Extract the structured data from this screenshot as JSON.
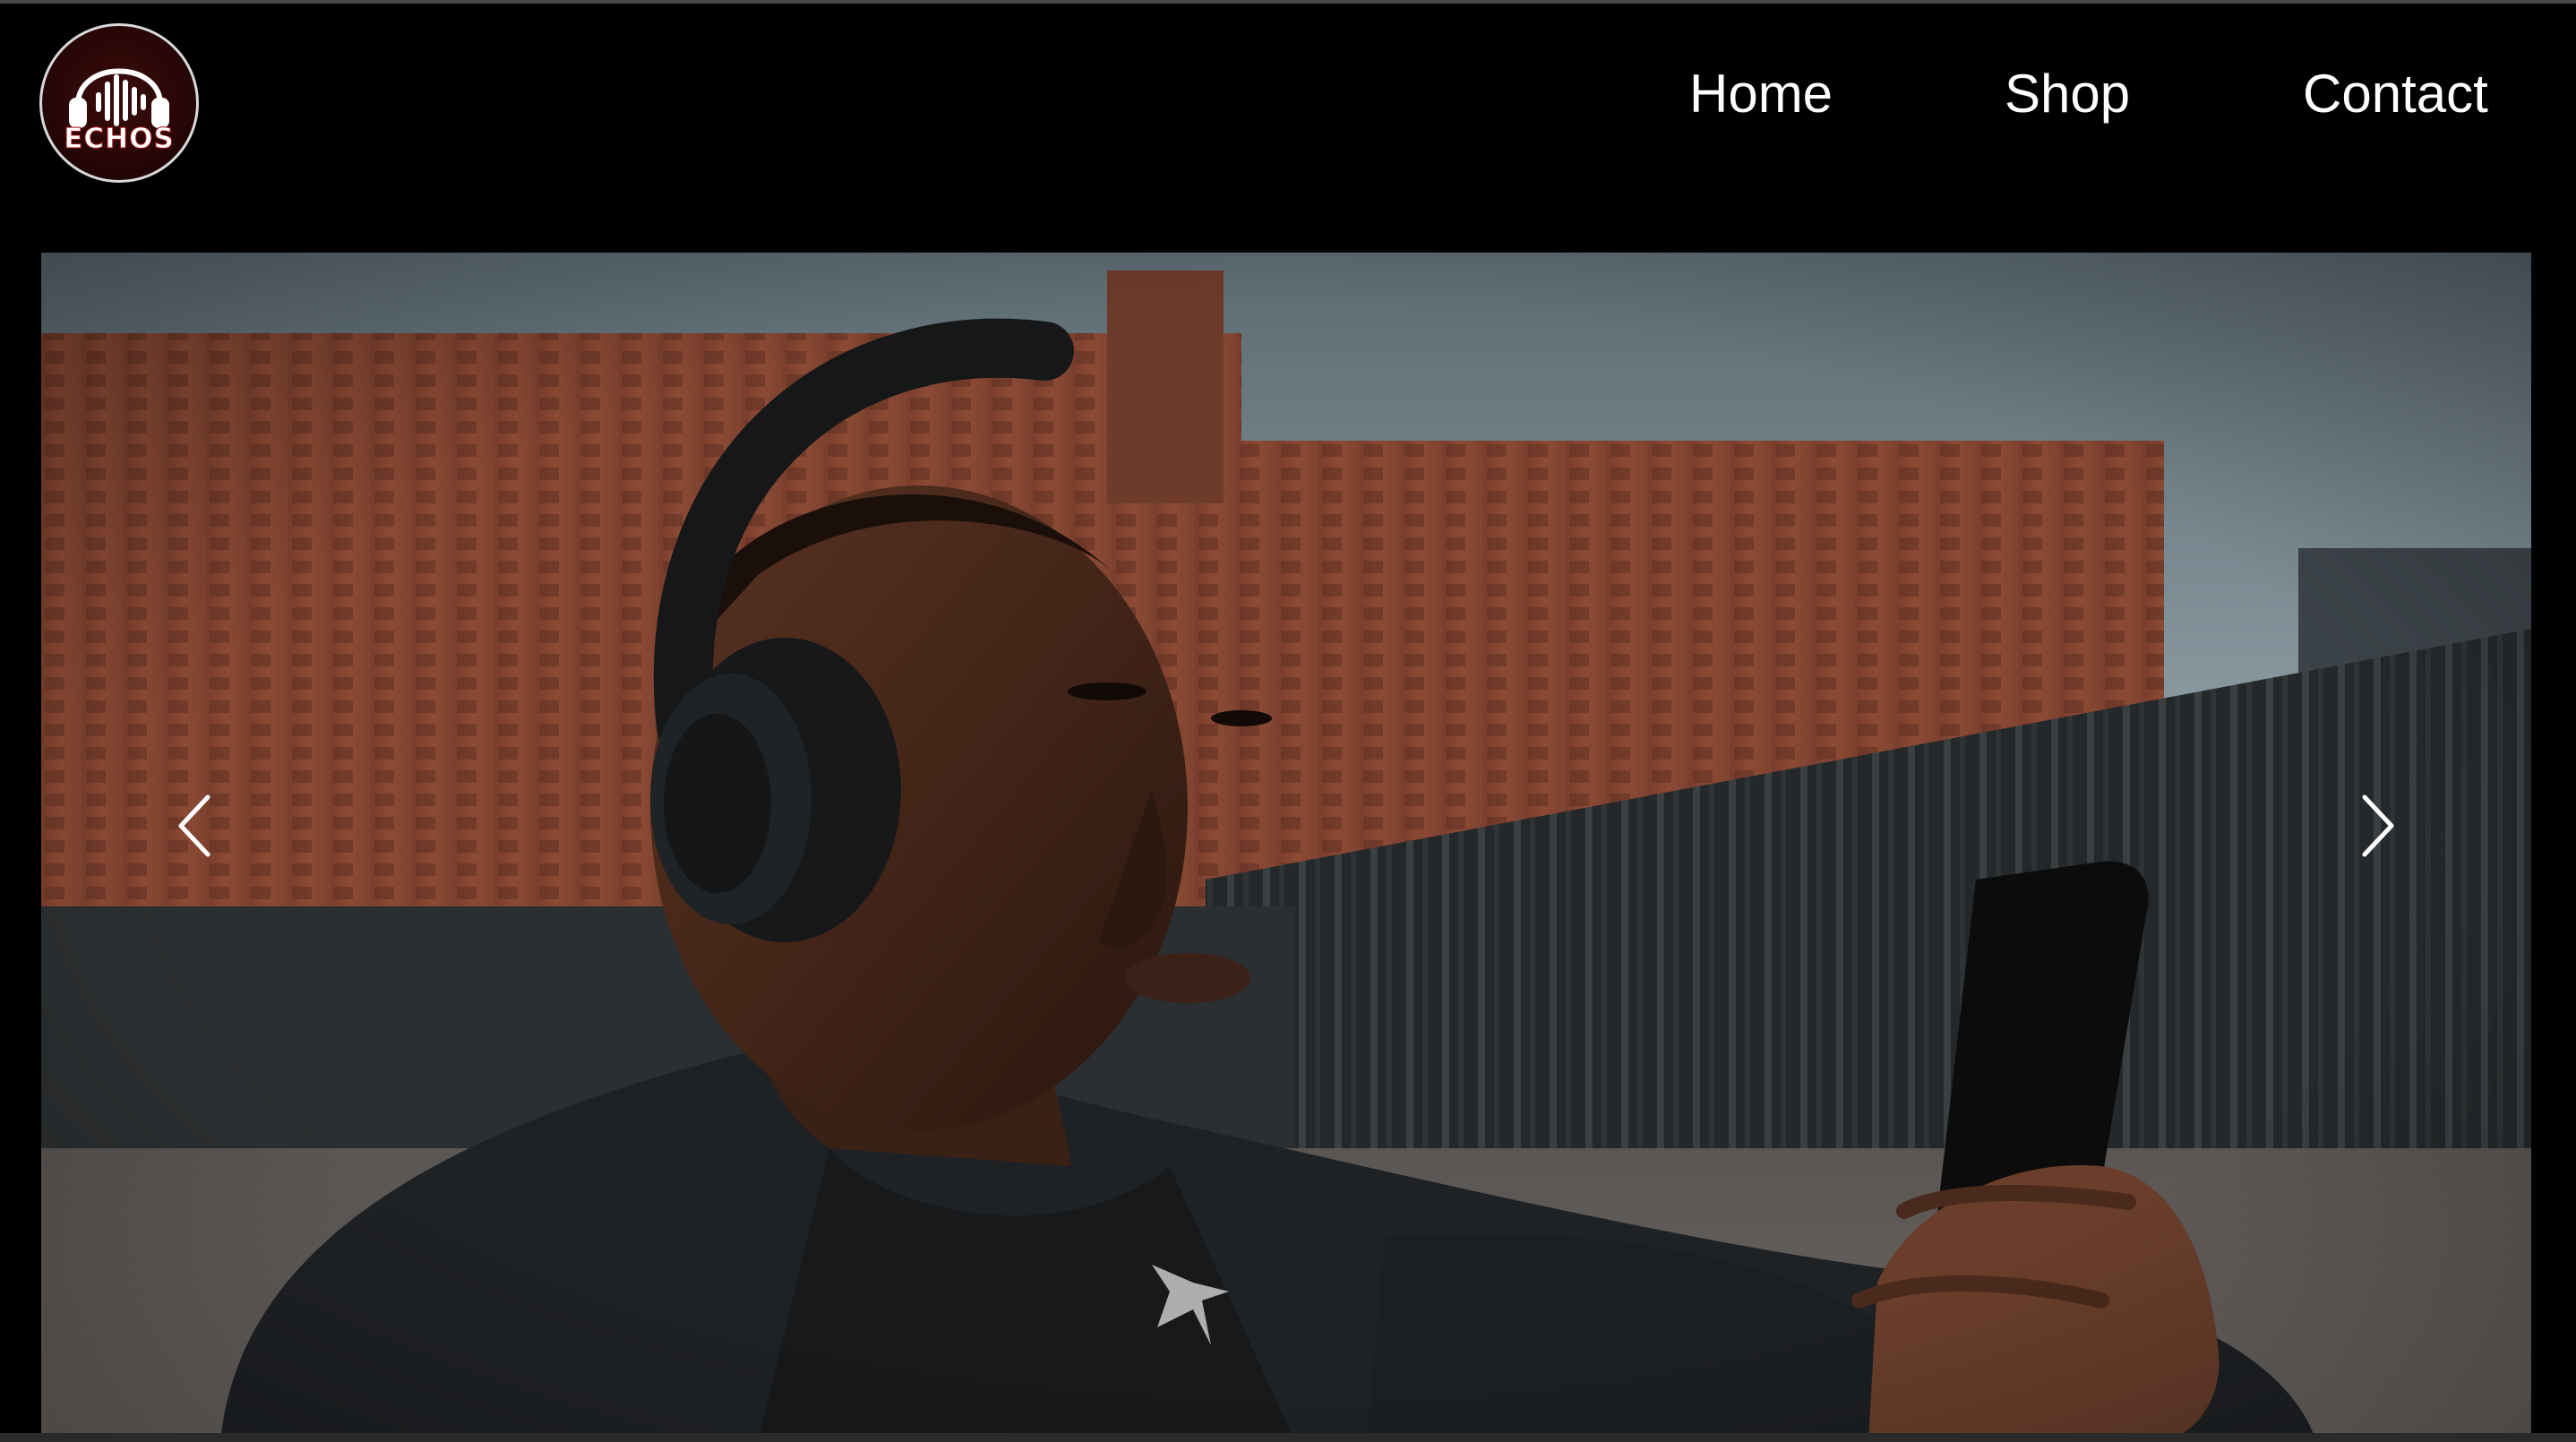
{
  "brand": {
    "logo_text": "ECHOS",
    "logo_icon": "headphones-soundwave-icon",
    "accent_color": "#a01616"
  },
  "nav": {
    "items": [
      {
        "label": "Home"
      },
      {
        "label": "Shop"
      },
      {
        "label": "Contact"
      }
    ]
  },
  "carousel": {
    "slide_image": "man-wearing-headphones-looking-at-phone",
    "prev_icon": "chevron-left-icon",
    "next_icon": "chevron-right-icon"
  }
}
